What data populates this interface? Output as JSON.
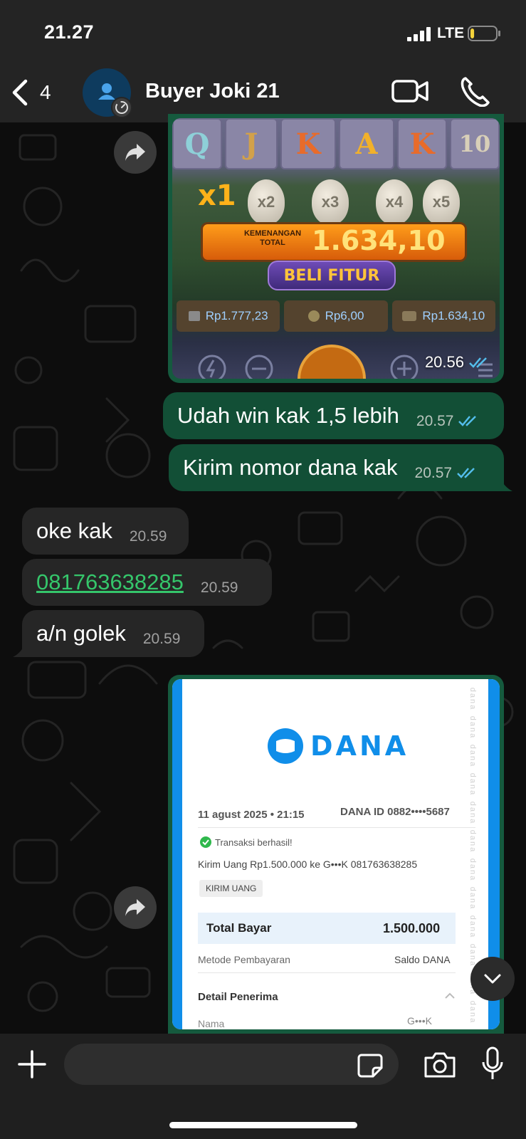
{
  "status_bar": {
    "time": "21.27",
    "network": "LTE",
    "battery_level": 0.15,
    "battery_color": "#f5d33b"
  },
  "header": {
    "back_count": "4",
    "contact_name": "Buyer Joki 21",
    "avatar_icon": "person-icon",
    "video_icon": "video-camera-icon",
    "call_icon": "phone-icon"
  },
  "messages": [
    {
      "type": "image",
      "direction": "out",
      "time": "20.56",
      "status": "read",
      "image": {
        "reel_symbols": [
          "Q",
          "J",
          "K",
          "A",
          "K",
          "10"
        ],
        "multiplier": "x1",
        "eggs": [
          "x2",
          "x3",
          "x4",
          "x5"
        ],
        "win_label": "KEMENANGAN TOTAL",
        "win_amount": "1.634,10",
        "buy_feature": "BELI FITUR",
        "balance": "Rp1.777,23",
        "bet": "Rp6,00",
        "win": "Rp1.634,10"
      }
    },
    {
      "type": "text",
      "direction": "out",
      "text": "Udah win kak 1,5 lebih",
      "time": "20.57",
      "status": "read"
    },
    {
      "type": "text",
      "direction": "out",
      "text": "Kirim nomor dana kak",
      "time": "20.57",
      "status": "read"
    },
    {
      "type": "text",
      "direction": "in",
      "text": "oke kak",
      "time": "20.59"
    },
    {
      "type": "link",
      "direction": "in",
      "text": "081763638285",
      "time": "20.59"
    },
    {
      "type": "text",
      "direction": "in",
      "text": "a/n golek",
      "time": "20.59"
    },
    {
      "type": "image",
      "direction": "out",
      "receipt": {
        "brand": "DANA",
        "date": "11 agust 2025 • 21:15",
        "dana_id": "DANA ID 0882••••5687",
        "status": "Transaksi berhasil!",
        "description": "Kirim Uang Rp1.500.000 ke G•••K 081763638285",
        "tag": "KIRIM UANG",
        "total_label": "Total Bayar",
        "total_value": "1.500.000",
        "method_label": "Metode Pembayaran",
        "method_value": "Saldo DANA",
        "detail_label": "Detail Penerima",
        "name_label": "Nama",
        "name_value": "G•••K",
        "watermark": "DANA"
      }
    }
  ],
  "composer": {
    "placeholder": "",
    "value": ""
  },
  "colors": {
    "outgoing_bubble": "#124f36",
    "incoming_bubble": "#262626",
    "link": "#35c66b",
    "read_ticks": "#53bdeb",
    "dana_blue": "#108ee9"
  }
}
